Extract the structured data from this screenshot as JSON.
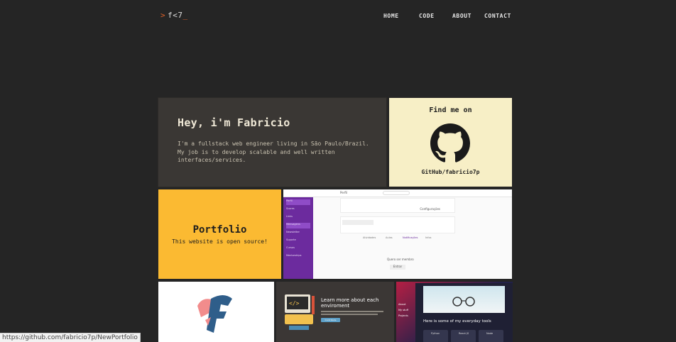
{
  "header": {
    "logo_arrow": ">",
    "logo_text": "f<7",
    "logo_cursor": "_",
    "nav": [
      {
        "label": "HOME"
      },
      {
        "label": "CODE"
      },
      {
        "label": "ABOUT"
      },
      {
        "label": "CONTACT"
      }
    ]
  },
  "intro": {
    "title": "Hey, i'm Fabricio",
    "text": "I'm a fullstack web engineer living in São Paulo/Brazil. My job is to develop scalable and well written interfaces/services."
  },
  "social": {
    "title": "Find me on",
    "icon": "github-icon",
    "handle": "GitHub/fabricio7p"
  },
  "portfolio": {
    "title": "Portfolio",
    "subtitle": "This website is open source!"
  },
  "project_screenshot": {
    "app_name": "Perfil",
    "menu": [
      "Perfil",
      "Scores",
      "Links",
      "Mensagens",
      "Newsletter",
      "Suporte",
      "Cursos",
      "Mentorships"
    ],
    "settings_label": "Configurações",
    "tabs": [
      "Atividades",
      "Aulas",
      "Notificações",
      "Infos"
    ],
    "member_label": "Quero ser membro",
    "button": "Entrar"
  },
  "learn_card": {
    "title": "Learn more about each enviroment",
    "button": "Contribute"
  },
  "tools_card": {
    "caption": "Here is some of my everyday tools",
    "menu": [
      "About",
      "My stuff",
      "Projects"
    ],
    "chips": [
      "Python",
      "React JS",
      "Node"
    ]
  },
  "status_bar": {
    "url": "https://github.com/fabricio7p/NewPortfolio"
  },
  "colors": {
    "background": "#252525",
    "accent": "#e0622a",
    "portfolio": "#fbba32",
    "social": "#f7efc6"
  }
}
